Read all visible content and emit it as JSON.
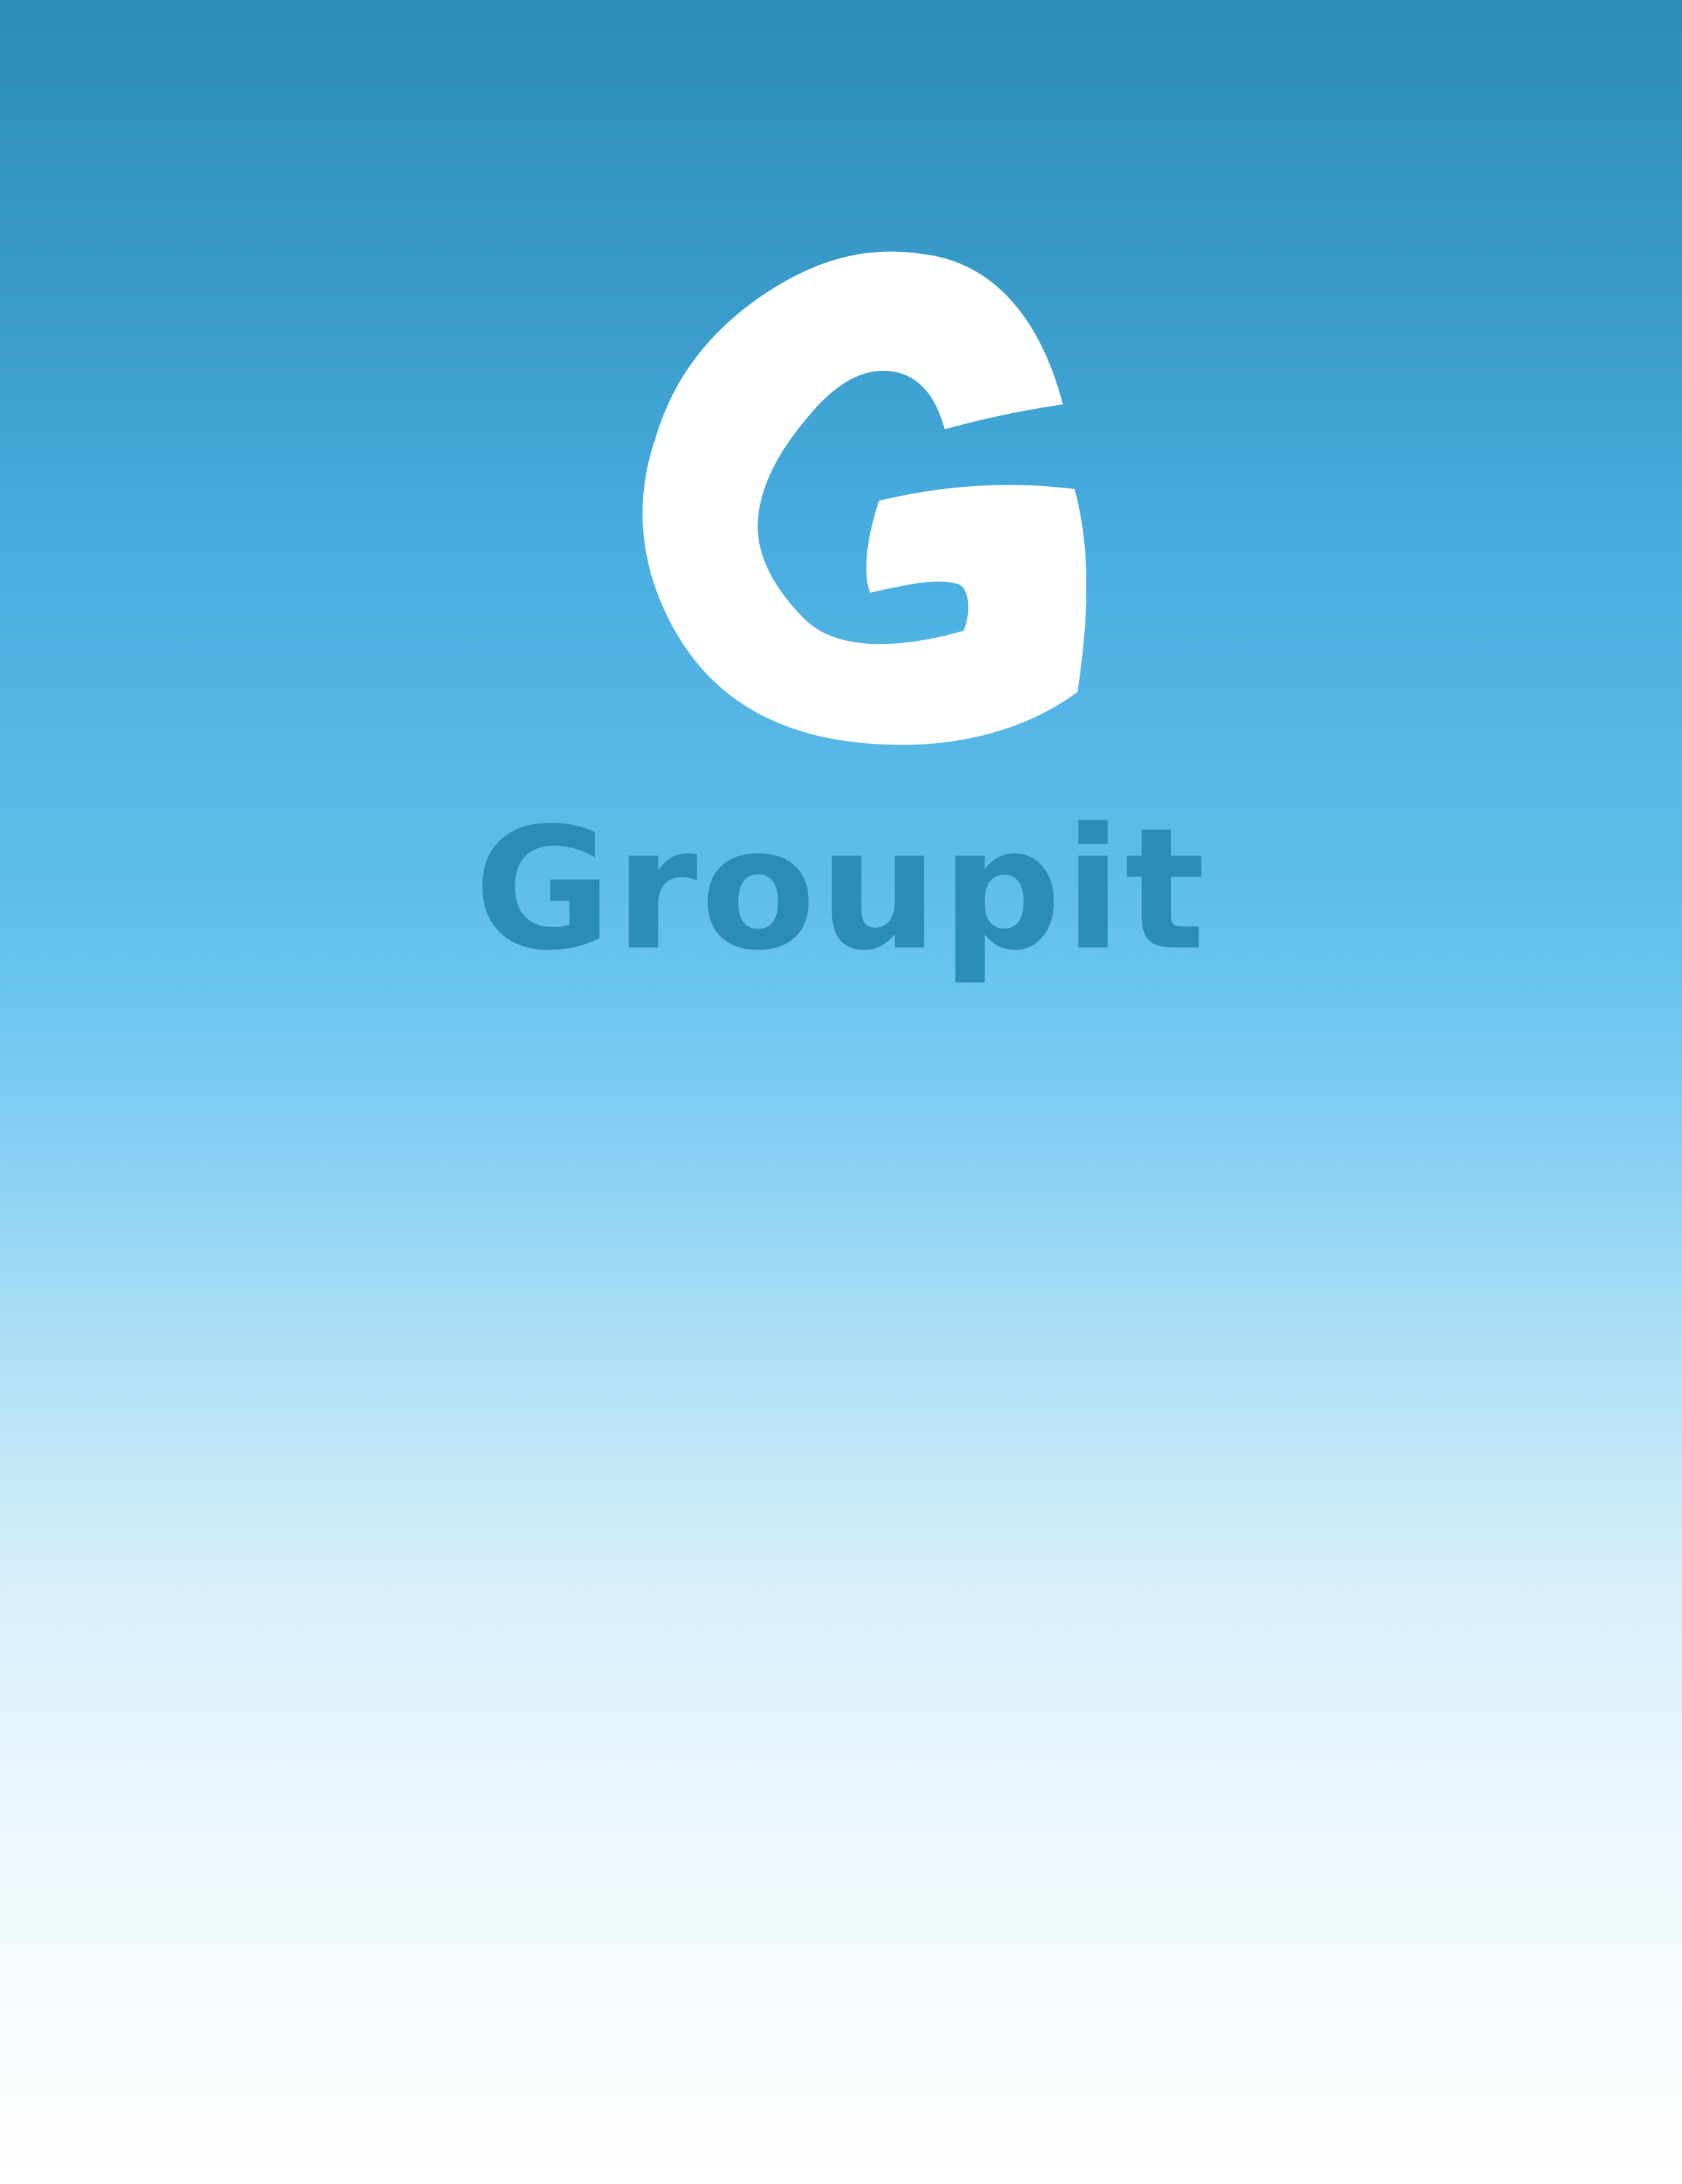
{
  "app": {
    "name": "Groupit"
  },
  "logo": {
    "icon": "groupit-g-logo-icon",
    "letter": "G",
    "color": "#ffffff"
  },
  "colors": {
    "background_top": "#2a8db8",
    "background_bottom": "#ffffff",
    "brand_text": "#2a8db8"
  }
}
